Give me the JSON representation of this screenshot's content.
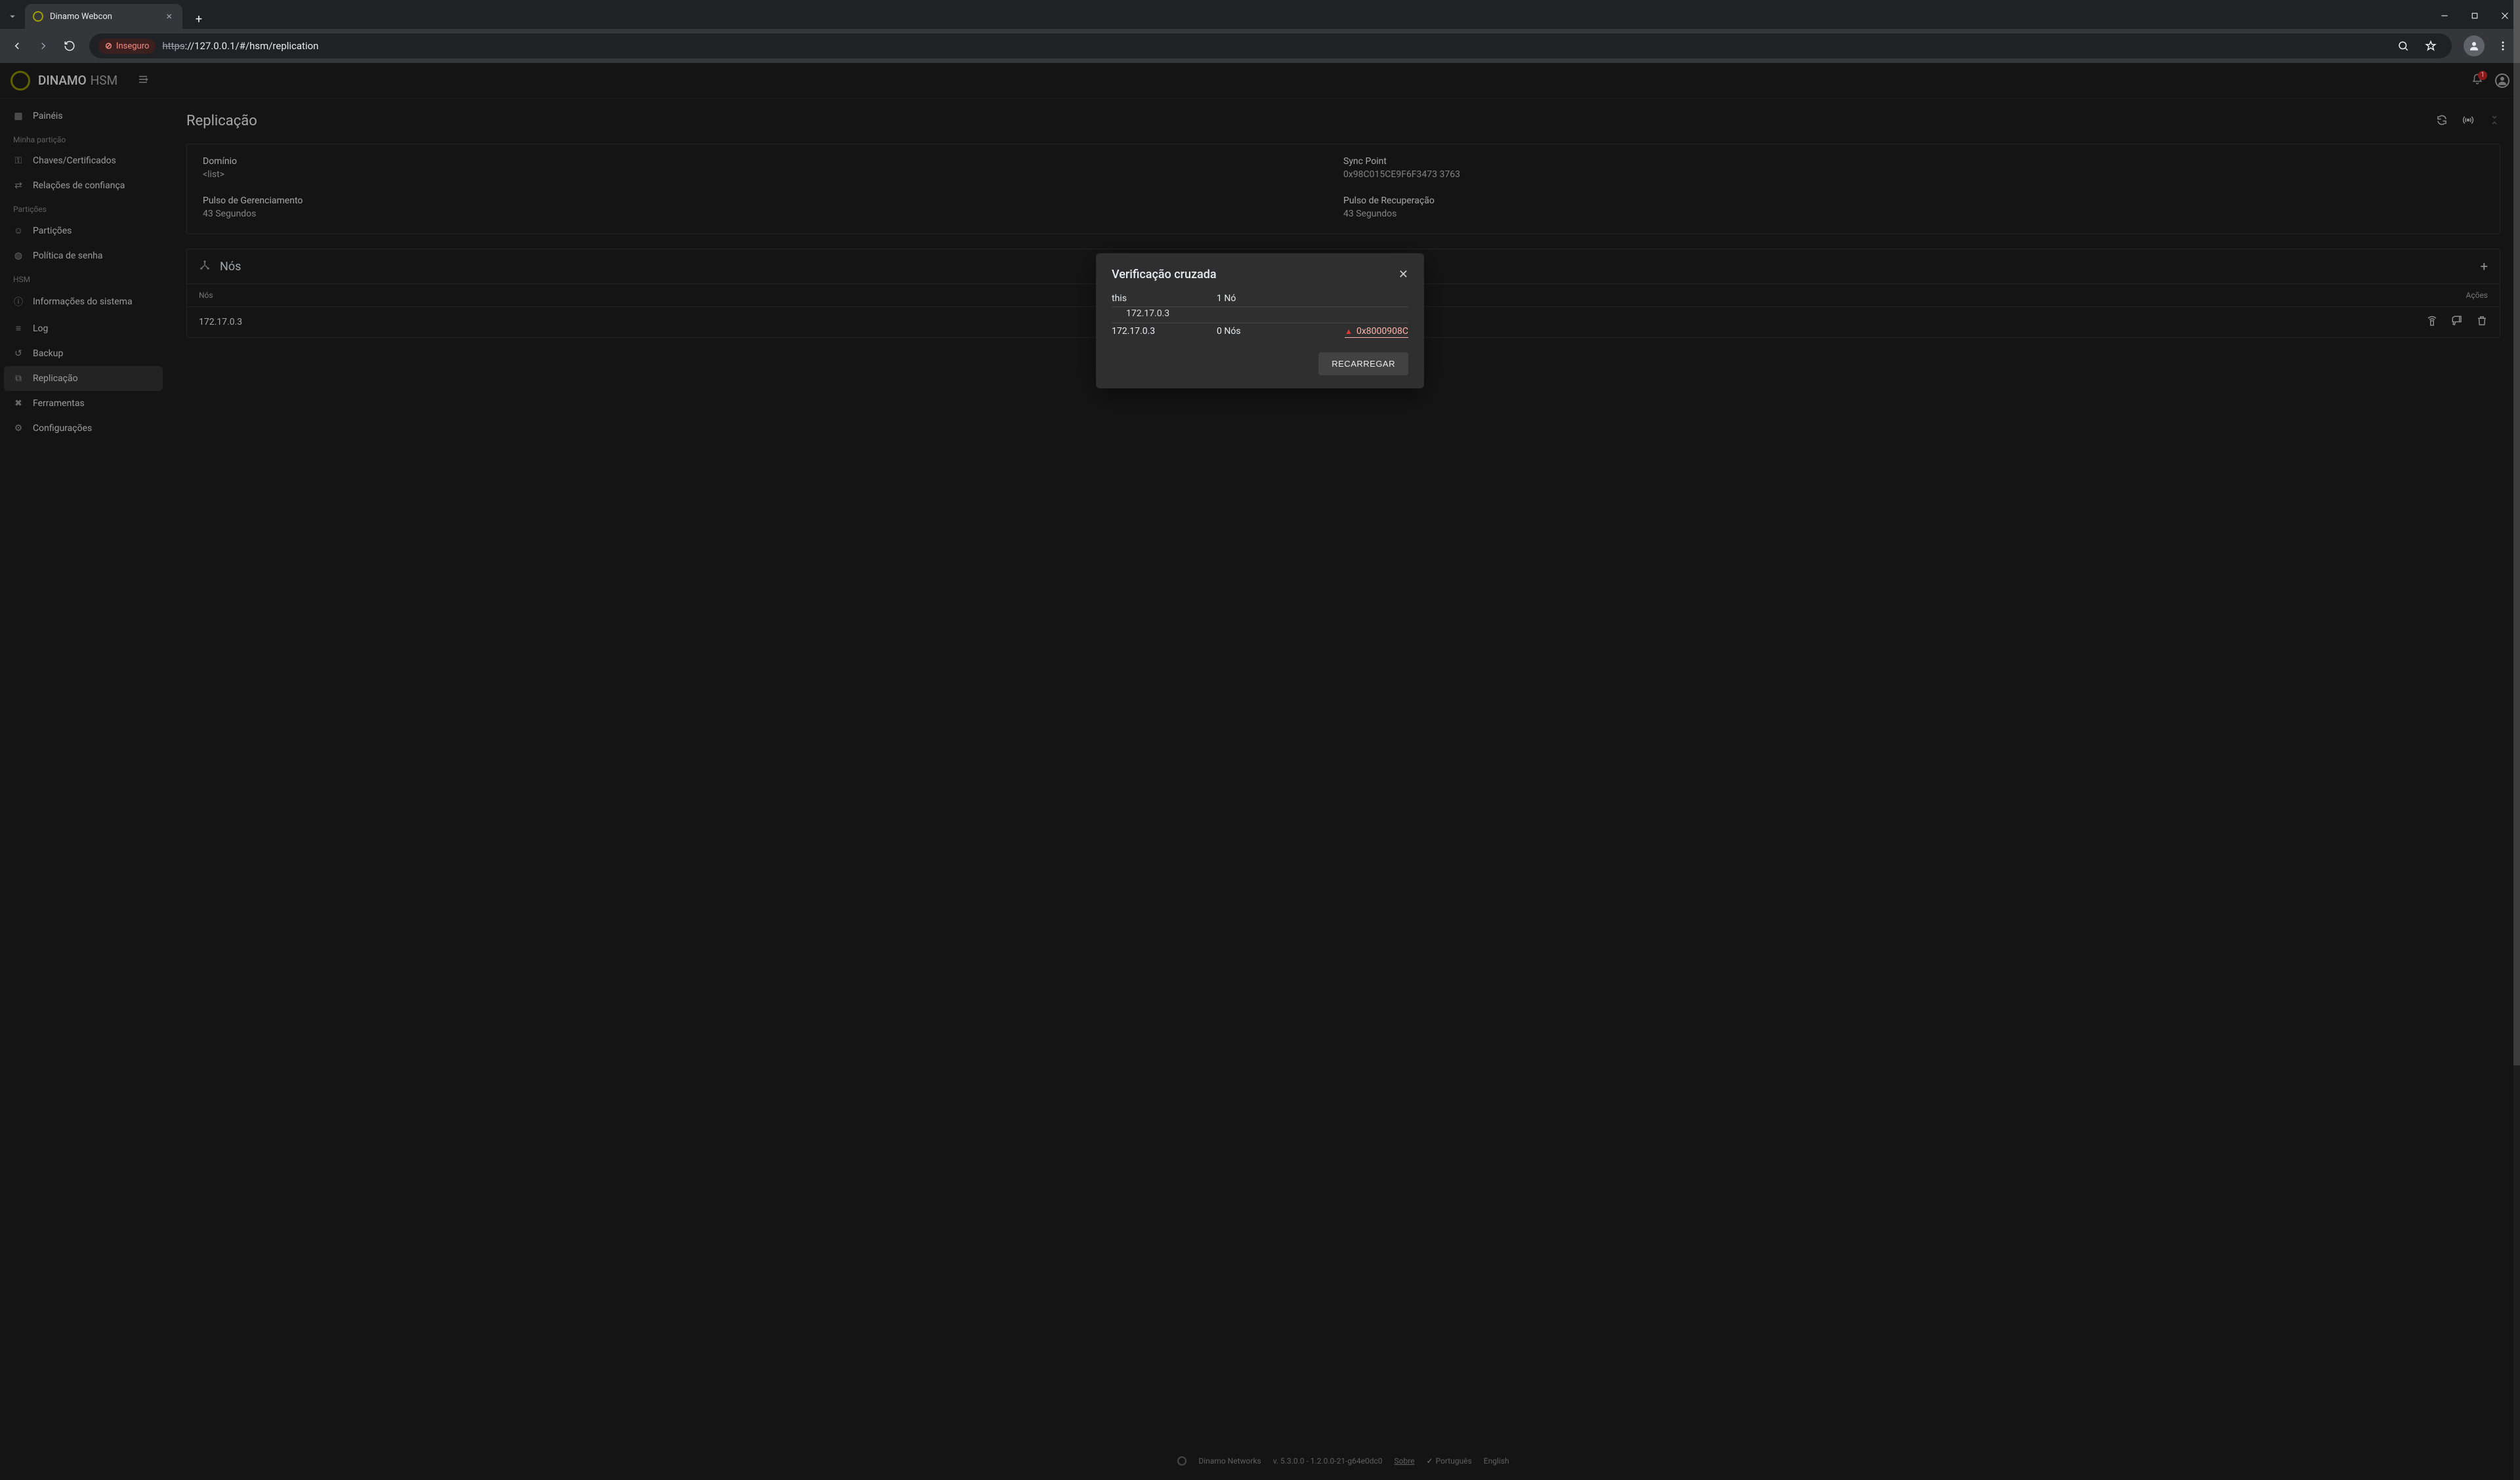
{
  "browser": {
    "tab_title": "Dinamo Webcon",
    "insecure_label": "Inseguro",
    "url_proto": "https",
    "url_rest": "://127.0.0.1/#/hsm/replication"
  },
  "header": {
    "brand": "DINAMO",
    "brand_sub": "HSM",
    "notif_count": "1"
  },
  "sidebar": {
    "sections": {
      "my_partition": "Minha partição",
      "partitions": "Partições",
      "hsm": "HSM"
    },
    "items": {
      "panels": "Painéis",
      "keys": "Chaves/Certificados",
      "trust": "Relações de confiança",
      "partitions": "Partições",
      "password": "Política de senha",
      "sysinfo": "Informações do sistema",
      "log": "Log",
      "backup": "Backup",
      "replication": "Replicação",
      "tools": "Ferramentas",
      "settings": "Configurações"
    }
  },
  "page": {
    "title": "Replicação",
    "domain_label": "Domínio",
    "domain_value": "<list>",
    "sync_label": "Sync Point",
    "sync_value": "0x98C015CE9F6F3473 3763",
    "mgmt_pulse_label": "Pulso de Gerenciamento",
    "mgmt_pulse_value": "43 Segundos",
    "recov_pulse_label": "Pulso de Recuperação",
    "recov_pulse_value": "43 Segundos"
  },
  "nodes": {
    "title": "Nós",
    "col_nodes": "Nós",
    "col_actions": "Ações",
    "rows": [
      {
        "ip": "172.17.0.3"
      }
    ]
  },
  "modal": {
    "title": "Verificação cruzada",
    "rows": [
      {
        "name": "this",
        "count": "1 Nó",
        "sub": "172.17.0.3",
        "error": ""
      },
      {
        "name": "172.17.0.3",
        "count": "0 Nós",
        "sub": "",
        "error": "0x8000908C"
      }
    ],
    "reload": "RECARREGAR"
  },
  "footer": {
    "company": "Dinamo Networks",
    "version": "v. 5.3.0.0 - 1.2.0.0-21-g64e0dc0",
    "about": "Sobre",
    "lang_pt": "Português",
    "lang_en": "English"
  }
}
